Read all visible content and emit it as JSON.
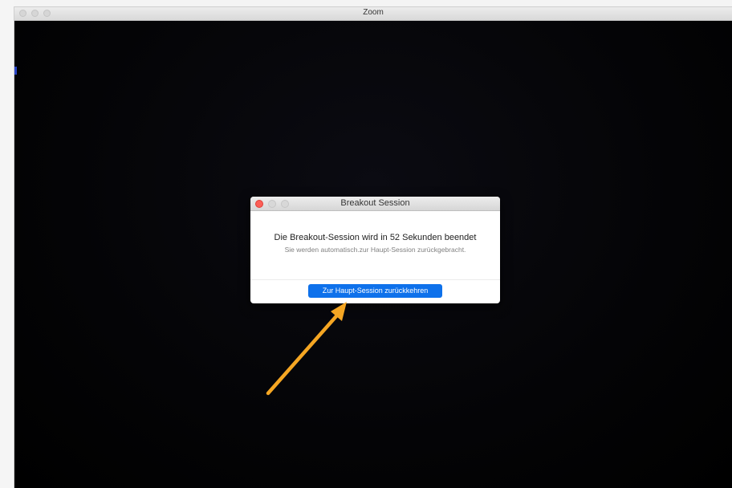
{
  "window": {
    "title": "Zoom",
    "close_icon": "traffic-light-close-icon",
    "minimize_icon": "traffic-light-minimize-icon",
    "zoom_icon": "traffic-light-zoom-icon"
  },
  "dialog": {
    "title": "Breakout Session",
    "heading": "Die Breakout-Session wird in 52 Sekunden beendet",
    "subtext": "Sie werden automatisch.zur Haupt-Session zurückgebracht.",
    "button_label": "Zur Haupt-Session zurückkehren",
    "countdown_seconds": 52
  },
  "annotation": {
    "icon": "arrow-icon",
    "color": "#f5a623"
  },
  "colors": {
    "button_blue": "#0e71eb",
    "close_red": "#fc5f57"
  }
}
